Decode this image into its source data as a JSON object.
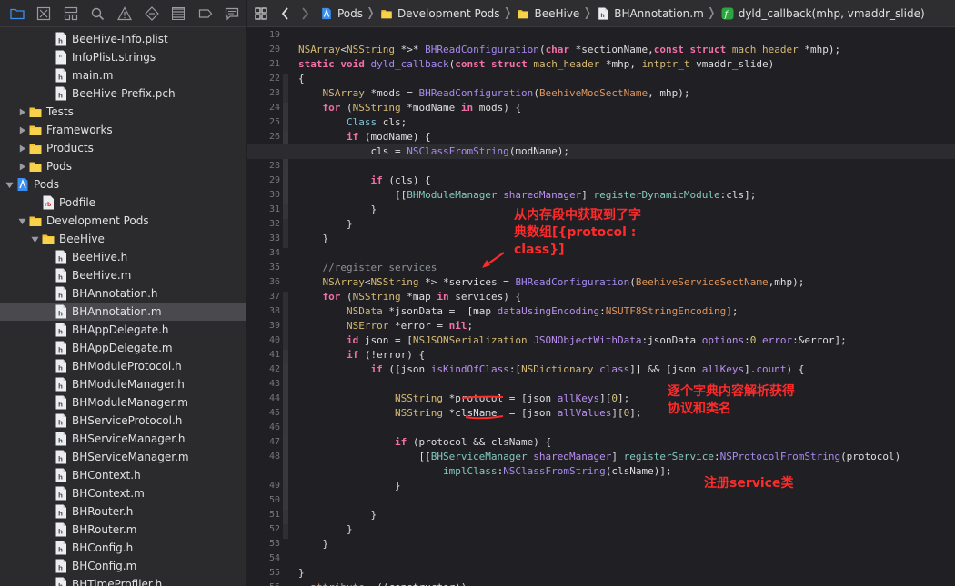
{
  "navigator": {
    "toolbar_icons": [
      "folder-icon",
      "source-control-icon",
      "hierarchy-icon",
      "search-icon",
      "warning-icon",
      "test-icon",
      "debug-icon",
      "breakpoint-icon",
      "report-icon"
    ],
    "items": [
      {
        "label": "BeeHive-Info.plist",
        "type": "file",
        "indent": 3
      },
      {
        "label": "InfoPlist.strings",
        "type": "strings",
        "indent": 3
      },
      {
        "label": "main.m",
        "type": "file",
        "indent": 3
      },
      {
        "label": "BeeHive-Prefix.pch",
        "type": "file",
        "indent": 3
      },
      {
        "label": "Tests",
        "type": "folder",
        "indent": 1,
        "disclosure": "closed"
      },
      {
        "label": "Frameworks",
        "type": "folder",
        "indent": 1,
        "disclosure": "closed"
      },
      {
        "label": "Products",
        "type": "folder",
        "indent": 1,
        "disclosure": "closed"
      },
      {
        "label": "Pods",
        "type": "folder",
        "indent": 1,
        "disclosure": "closed"
      },
      {
        "label": "Pods",
        "type": "project",
        "indent": 0,
        "disclosure": "open"
      },
      {
        "label": "Podfile",
        "type": "rb",
        "indent": 2
      },
      {
        "label": "Development Pods",
        "type": "folder",
        "indent": 1,
        "disclosure": "open"
      },
      {
        "label": "BeeHive",
        "type": "folder",
        "indent": 2,
        "disclosure": "open"
      },
      {
        "label": "BeeHive.h",
        "type": "file",
        "indent": 3
      },
      {
        "label": "BeeHive.m",
        "type": "file",
        "indent": 3
      },
      {
        "label": "BHAnnotation.h",
        "type": "file",
        "indent": 3
      },
      {
        "label": "BHAnnotation.m",
        "type": "file",
        "indent": 3,
        "selected": true
      },
      {
        "label": "BHAppDelegate.h",
        "type": "file",
        "indent": 3
      },
      {
        "label": "BHAppDelegate.m",
        "type": "file",
        "indent": 3
      },
      {
        "label": "BHModuleProtocol.h",
        "type": "file",
        "indent": 3
      },
      {
        "label": "BHModuleManager.h",
        "type": "file",
        "indent": 3
      },
      {
        "label": "BHModuleManager.m",
        "type": "file",
        "indent": 3
      },
      {
        "label": "BHServiceProtocol.h",
        "type": "file",
        "indent": 3
      },
      {
        "label": "BHServiceManager.h",
        "type": "file",
        "indent": 3
      },
      {
        "label": "BHServiceManager.m",
        "type": "file",
        "indent": 3
      },
      {
        "label": "BHContext.h",
        "type": "file",
        "indent": 3
      },
      {
        "label": "BHContext.m",
        "type": "file",
        "indent": 3
      },
      {
        "label": "BHRouter.h",
        "type": "file",
        "indent": 3
      },
      {
        "label": "BHRouter.m",
        "type": "file",
        "indent": 3
      },
      {
        "label": "BHConfig.h",
        "type": "file",
        "indent": 3
      },
      {
        "label": "BHConfig.m",
        "type": "file",
        "indent": 3
      },
      {
        "label": "BHTimeProfiler.h",
        "type": "file",
        "indent": 3
      }
    ]
  },
  "jumpbar": {
    "crumbs": [
      {
        "label": "Pods",
        "icon": "project-icon"
      },
      {
        "label": "Development Pods",
        "icon": "folder-icon"
      },
      {
        "label": "BeeHive",
        "icon": "folder-icon"
      },
      {
        "label": "BHAnnotation.m",
        "icon": "file-icon"
      },
      {
        "label": "dyld_callback(mhp, vmaddr_slide)",
        "icon": "function-icon"
      }
    ]
  },
  "editor": {
    "current_line": 27,
    "lines": [
      {
        "n": "19",
        "code": []
      },
      {
        "n": "20",
        "code": [
          [
            "tp",
            "NSArray"
          ],
          [
            "pl",
            "<"
          ],
          [
            "tp",
            "NSString"
          ],
          [
            "pl",
            " *>* "
          ],
          [
            "fn",
            "BHReadConfiguration"
          ],
          [
            "pl",
            "("
          ],
          [
            "kw",
            "char"
          ],
          [
            "pl",
            " *sectionName,"
          ],
          [
            "kw",
            "const"
          ],
          [
            "pl",
            " "
          ],
          [
            "kw",
            "struct"
          ],
          [
            "pl",
            " "
          ],
          [
            "tp",
            "mach_header"
          ],
          [
            "pl",
            " *mhp);"
          ]
        ]
      },
      {
        "n": "21",
        "code": [
          [
            "kw",
            "static"
          ],
          [
            "pl",
            " "
          ],
          [
            "kw",
            "void"
          ],
          [
            "pl",
            " "
          ],
          [
            "fn",
            "dyld_callback"
          ],
          [
            "pl",
            "("
          ],
          [
            "kw",
            "const"
          ],
          [
            "pl",
            " "
          ],
          [
            "kw",
            "struct"
          ],
          [
            "pl",
            " "
          ],
          [
            "tp",
            "mach_header"
          ],
          [
            "pl",
            " *mhp, "
          ],
          [
            "tp",
            "intptr_t"
          ],
          [
            "pl",
            " vmaddr_slide)"
          ]
        ]
      },
      {
        "n": "22",
        "code": [
          [
            "pl",
            "{"
          ]
        ]
      },
      {
        "n": "23",
        "code": [
          [
            "pl",
            "    "
          ],
          [
            "tp",
            "NSArray"
          ],
          [
            "pl",
            " *mods = "
          ],
          [
            "fn",
            "BHReadConfiguration"
          ],
          [
            "pl",
            "("
          ],
          [
            "mac",
            "BeehiveModSectName"
          ],
          [
            "pl",
            ", mhp);"
          ]
        ]
      },
      {
        "n": "24",
        "code": [
          [
            "pl",
            "    "
          ],
          [
            "kw",
            "for"
          ],
          [
            "pl",
            " ("
          ],
          [
            "tp",
            "NSString"
          ],
          [
            "pl",
            " *modName "
          ],
          [
            "kw",
            "in"
          ],
          [
            "pl",
            " mods) {"
          ]
        ]
      },
      {
        "n": "25",
        "code": [
          [
            "pl",
            "        "
          ],
          [
            "cls",
            "Class"
          ],
          [
            "pl",
            " cls;"
          ]
        ]
      },
      {
        "n": "26",
        "code": [
          [
            "pl",
            "        "
          ],
          [
            "kw",
            "if"
          ],
          [
            "pl",
            " (modName) {"
          ]
        ]
      },
      {
        "n": "27",
        "code": [
          [
            "pl",
            "            cls = "
          ],
          [
            "fn",
            "NSClassFromString"
          ],
          [
            "pl",
            "(modName);"
          ]
        ]
      },
      {
        "n": "28",
        "code": []
      },
      {
        "n": "29",
        "code": [
          [
            "pl",
            "            "
          ],
          [
            "kw",
            "if"
          ],
          [
            "pl",
            " (cls) {"
          ]
        ]
      },
      {
        "n": "30",
        "code": [
          [
            "pl",
            "                [["
          ],
          [
            "pj",
            "BHModuleManager"
          ],
          [
            "pl",
            " "
          ],
          [
            "me",
            "sharedManager"
          ],
          [
            "pl",
            "] "
          ],
          [
            "pj",
            "registerDynamicModule"
          ],
          [
            "pl",
            ":cls];"
          ]
        ]
      },
      {
        "n": "31",
        "code": [
          [
            "pl",
            "            }"
          ]
        ]
      },
      {
        "n": "32",
        "code": [
          [
            "pl",
            "        }"
          ]
        ]
      },
      {
        "n": "33",
        "code": [
          [
            "pl",
            "    }"
          ]
        ]
      },
      {
        "n": "34",
        "code": []
      },
      {
        "n": "35",
        "code": [
          [
            "pl",
            "    "
          ],
          [
            "cm",
            "//register services"
          ]
        ]
      },
      {
        "n": "36",
        "code": [
          [
            "pl",
            "    "
          ],
          [
            "tp",
            "NSArray"
          ],
          [
            "pl",
            "<"
          ],
          [
            "tp",
            "NSString"
          ],
          [
            "pl",
            " *> *services = "
          ],
          [
            "fn",
            "BHReadConfiguration"
          ],
          [
            "pl",
            "("
          ],
          [
            "mac",
            "BeehiveServiceSectName"
          ],
          [
            "pl",
            ",mhp);"
          ]
        ]
      },
      {
        "n": "37",
        "code": [
          [
            "pl",
            "    "
          ],
          [
            "kw",
            "for"
          ],
          [
            "pl",
            " ("
          ],
          [
            "tp",
            "NSString"
          ],
          [
            "pl",
            " *map "
          ],
          [
            "kw",
            "in"
          ],
          [
            "pl",
            " services) {"
          ]
        ]
      },
      {
        "n": "38",
        "code": [
          [
            "pl",
            "        "
          ],
          [
            "tp",
            "NSData"
          ],
          [
            "pl",
            " *jsonData =  [map "
          ],
          [
            "me",
            "dataUsingEncoding"
          ],
          [
            "pl",
            ":"
          ],
          [
            "mac",
            "NSUTF8StringEncoding"
          ],
          [
            "pl",
            "];"
          ]
        ]
      },
      {
        "n": "39",
        "code": [
          [
            "pl",
            "        "
          ],
          [
            "tp",
            "NSError"
          ],
          [
            "pl",
            " *error = "
          ],
          [
            "kw",
            "nil"
          ],
          [
            "pl",
            ";"
          ]
        ]
      },
      {
        "n": "40",
        "code": [
          [
            "pl",
            "        "
          ],
          [
            "kw",
            "id"
          ],
          [
            "pl",
            " json = ["
          ],
          [
            "tp",
            "NSJSONSerialization"
          ],
          [
            "pl",
            " "
          ],
          [
            "me",
            "JSONObjectWithData"
          ],
          [
            "pl",
            ":jsonData "
          ],
          [
            "me",
            "options"
          ],
          [
            "pl",
            ":"
          ],
          [
            "num",
            "0"
          ],
          [
            "pl",
            " "
          ],
          [
            "me",
            "error"
          ],
          [
            "pl",
            ":&error];"
          ]
        ]
      },
      {
        "n": "41",
        "code": [
          [
            "pl",
            "        "
          ],
          [
            "kw",
            "if"
          ],
          [
            "pl",
            " (!error) {"
          ]
        ]
      },
      {
        "n": "42",
        "code": [
          [
            "pl",
            "            "
          ],
          [
            "kw",
            "if"
          ],
          [
            "pl",
            " ([json "
          ],
          [
            "me",
            "isKindOfClass"
          ],
          [
            "pl",
            ":["
          ],
          [
            "tp",
            "NSDictionary"
          ],
          [
            "pl",
            " "
          ],
          [
            "me",
            "class"
          ],
          [
            "pl",
            "]] && [json "
          ],
          [
            "me",
            "allKeys"
          ],
          [
            "pl",
            "]."
          ],
          [
            "me",
            "count"
          ],
          [
            "pl",
            ") {"
          ]
        ]
      },
      {
        "n": "43",
        "code": []
      },
      {
        "n": "44",
        "code": [
          [
            "pl",
            "                "
          ],
          [
            "tp",
            "NSString"
          ],
          [
            "pl",
            " *protocol = [json "
          ],
          [
            "me",
            "allKeys"
          ],
          [
            "pl",
            "]["
          ],
          [
            "num",
            "0"
          ],
          [
            "pl",
            "];"
          ]
        ]
      },
      {
        "n": "45",
        "code": [
          [
            "pl",
            "                "
          ],
          [
            "tp",
            "NSString"
          ],
          [
            "pl",
            " *clsName  = [json "
          ],
          [
            "me",
            "allValues"
          ],
          [
            "pl",
            "]["
          ],
          [
            "num",
            "0"
          ],
          [
            "pl",
            "];"
          ]
        ]
      },
      {
        "n": "46",
        "code": []
      },
      {
        "n": "47",
        "code": [
          [
            "pl",
            "                "
          ],
          [
            "kw",
            "if"
          ],
          [
            "pl",
            " (protocol && clsName) {"
          ]
        ]
      },
      {
        "n": "48",
        "code": [
          [
            "pl",
            "                    [["
          ],
          [
            "pj",
            "BHServiceManager"
          ],
          [
            "pl",
            " "
          ],
          [
            "me",
            "sharedManager"
          ],
          [
            "pl",
            "] "
          ],
          [
            "pj",
            "registerService"
          ],
          [
            "pl",
            ":"
          ],
          [
            "fn",
            "NSProtocolFromString"
          ],
          [
            "pl",
            "(protocol)"
          ]
        ]
      },
      {
        "n": "",
        "code": [
          [
            "pl",
            "                        "
          ],
          [
            "pj",
            "implClass"
          ],
          [
            "pl",
            ":"
          ],
          [
            "fn",
            "NSClassFromString"
          ],
          [
            "pl",
            "(clsName)];"
          ]
        ]
      },
      {
        "n": "49",
        "code": [
          [
            "pl",
            "                }"
          ]
        ]
      },
      {
        "n": "50",
        "code": []
      },
      {
        "n": "51",
        "code": [
          [
            "pl",
            "            }"
          ]
        ]
      },
      {
        "n": "52",
        "code": [
          [
            "pl",
            "        }"
          ]
        ]
      },
      {
        "n": "53",
        "code": [
          [
            "pl",
            "    }"
          ]
        ]
      },
      {
        "n": "54",
        "code": []
      },
      {
        "n": "55",
        "code": [
          [
            "pl",
            "}"
          ]
        ]
      },
      {
        "n": "56",
        "code": [
          [
            "mac",
            "__attribute__"
          ],
          [
            "pl",
            "((constructor))"
          ]
        ]
      }
    ]
  },
  "annotations": {
    "note1": "从内存段中获取到了字典数组[{protocol : class}]",
    "note2": "逐个字典内容解析获得协议和类名",
    "note3": "注册service类",
    "color": "#ff2b2b"
  },
  "colors": {
    "background": "#1f1f24",
    "sidebar": "#2b2b2e",
    "selected_row": "#4a4a4e",
    "keyword": "#f470a8",
    "type": "#d6ba73",
    "function": "#a78af0",
    "comment": "#8d9298",
    "folder": "#f5c431",
    "accent": "#3b8ef0"
  }
}
